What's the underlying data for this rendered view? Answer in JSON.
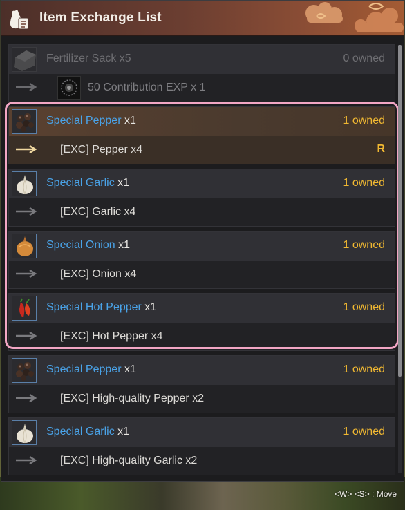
{
  "window": {
    "title": "Item Exchange List",
    "title_icon": "sack-scroll-icon"
  },
  "entries": [
    {
      "item": "Fertilizer Sack",
      "qty": " x5",
      "owned": "0 owned",
      "reward": "50 Contribution EXP x 1",
      "icon": "fertilizer-sack-icon",
      "state": "unavailable"
    },
    {
      "item": "Special Pepper",
      "qty": " x1",
      "owned": "1 owned",
      "reward": "[EXC] Pepper x4",
      "mark": "R",
      "icon": "pepper-icon",
      "state": "selected"
    },
    {
      "item": "Special Garlic",
      "qty": " x1",
      "owned": "1 owned",
      "reward": "[EXC] Garlic x4",
      "icon": "garlic-icon",
      "state": "available"
    },
    {
      "item": "Special Onion",
      "qty": " x1",
      "owned": "1 owned",
      "reward": "[EXC] Onion x4",
      "icon": "onion-icon",
      "state": "available"
    },
    {
      "item": "Special Hot Pepper",
      "qty": " x1",
      "owned": "1 owned",
      "reward": "[EXC] Hot Pepper x4",
      "icon": "hot-pepper-icon",
      "state": "available"
    },
    {
      "item": "Special Pepper",
      "qty": " x1",
      "owned": "1 owned",
      "reward": "[EXC] High-quality Pepper x2",
      "icon": "pepper-icon",
      "state": "available"
    },
    {
      "item": "Special Garlic",
      "qty": " x1",
      "owned": "1 owned",
      "reward": "[EXC] High-quality Garlic x2",
      "icon": "garlic-icon",
      "state": "available"
    }
  ],
  "hint": "<W> <S> : Move",
  "colors": {
    "item_name": "#4aa3e8",
    "owned": "#f0b832",
    "highlight": "#f2a6c4",
    "title_bar": "#6b3e31"
  }
}
